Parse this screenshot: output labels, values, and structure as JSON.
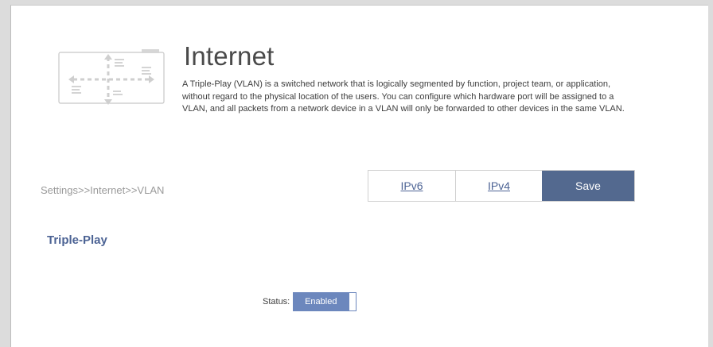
{
  "header": {
    "title": "Internet",
    "description": "A Triple-Play (VLAN) is a switched network that is logically segmented by function, project team, or application, without regard to the physical location of the users. You can configure which hardware port will be assigned to a VLAN, and all packets from a network device in a VLAN will only be forwarded to other devices in the same VLAN.",
    "icon": "network-map-icon"
  },
  "nav": {
    "breadcrumb": "Settings>>Internet>>VLAN",
    "ipv6_label": "IPv6",
    "ipv4_label": "IPv4",
    "save_label": "Save"
  },
  "section": {
    "title": "Triple-Play",
    "status_label": "Status:",
    "status_value": "Enabled"
  },
  "colors": {
    "accent": "#53698f",
    "toggle": "#6c87bd",
    "link": "#4c6394"
  }
}
